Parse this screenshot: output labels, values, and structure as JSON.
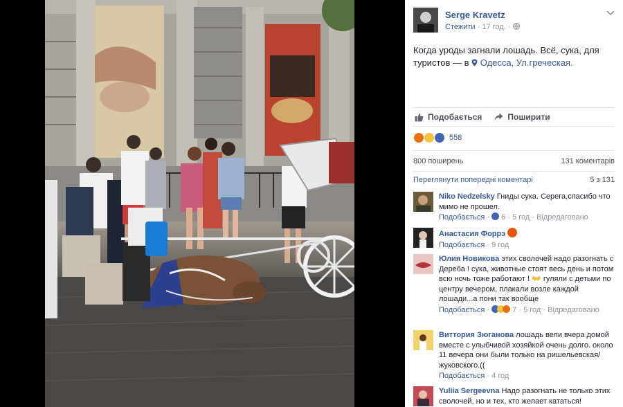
{
  "post": {
    "author": "Serge Kravetz",
    "follow": "Стежити",
    "time": "17 год.",
    "dot": "·",
    "text_main": "Когда уроды загнали лошадь. Всё, сука, для туристов",
    "text_at": " — в ",
    "place1": "Одесса",
    "comma": ", ",
    "place2": "Ул.греческая."
  },
  "actions": {
    "like": "Подобається",
    "share": "Поширити"
  },
  "reactions": {
    "count": "558"
  },
  "stats": {
    "shares": "800 поширень",
    "comments": "131 коментарів"
  },
  "previous": {
    "label": "Переглянути попередні коментарі",
    "range": "5 з 131"
  },
  "comments": [
    {
      "name": "Niko Nedzelsky",
      "text": " Гниды сука. Серега,спасибо что мимо не прошел.",
      "like": "Подобається",
      "reaction_count": "6",
      "time": "5 год",
      "edited": "Відредаговано"
    },
    {
      "name": "Анастасия Форрэ",
      "text": "",
      "like": "Подобається",
      "time": "9 год"
    },
    {
      "name": "Юлия Новикова",
      "text": " этих сволочей надо разогнать с Дереба !  сука, животные стоят весь день и потом всю ночь тоже работают ! 👐 гуляли с детьми по центру вечером, плакали возле каждой лошади...а пони так вообще",
      "like": "Подобається",
      "reaction_count": "7",
      "time": "5 год",
      "edited": "Відредаговано"
    },
    {
      "name": "Виттория Зюганова",
      "text": " лошадь вели вчера домой вместе с улыбчивой хозяйкой очень долго. около 11 вечера они были только на ришельевская/жуковского.((",
      "like": "Подобається",
      "time": "4 год"
    },
    {
      "name": "Yuliia Sergeevna",
      "text": " Надо разогнать не только этих сволочей, но и тех, кто желает кататься!"
    }
  ],
  "colors": {
    "link": "#365899",
    "meta": "#90949c",
    "angry": "#e9710f",
    "sad": "#f7c33b",
    "like": "#4267b2"
  },
  "icons": [
    "globe-icon",
    "chevron-down-icon",
    "thumbs-up-icon",
    "share-arrow-icon",
    "location-pin-icon"
  ]
}
